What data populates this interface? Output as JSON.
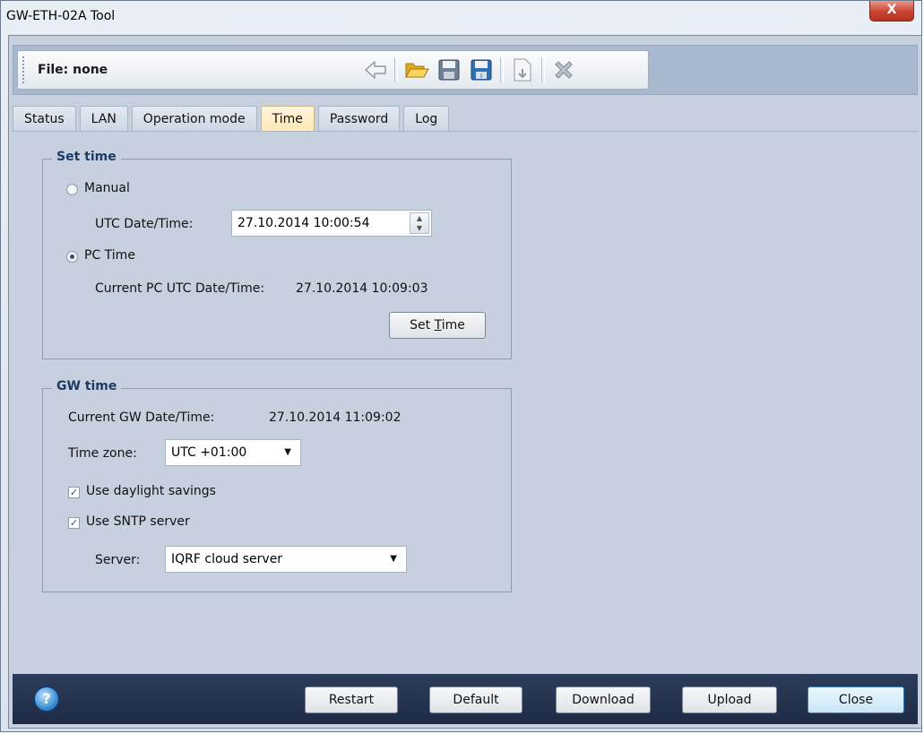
{
  "window": {
    "title": "GW-ETH-02A Tool",
    "close_glyph": "X"
  },
  "toolbar": {
    "file_label": "File: none",
    "icons": [
      "back-arrow-icon",
      "folder-open-icon",
      "save-icon",
      "save-as-icon",
      "export-document-icon",
      "delete-x-icon"
    ]
  },
  "tabs": [
    "Status",
    "LAN",
    "Operation mode",
    "Time",
    "Password",
    "Log"
  ],
  "active_tab": "Time",
  "set_time": {
    "legend": "Set time",
    "manual_label": "Manual",
    "utc_label": "UTC Date/Time:",
    "utc_value": "27.10.2014 10:00:54",
    "pc_time_label": "PC Time",
    "current_pc_label": "Current PC UTC Date/Time:",
    "current_pc_value": "27.10.2014 10:09:03",
    "set_time_button_pre": "Set ",
    "set_time_button_ul": "T",
    "set_time_button_post": "ime",
    "selected": "PC Time"
  },
  "gw_time": {
    "legend": "GW time",
    "current_gw_label": "Current GW Date/Time:",
    "current_gw_value": "27.10.2014 11:09:02",
    "timezone_label": "Time zone:",
    "timezone_value": "UTC +01:00",
    "daylight_label": "Use daylight savings",
    "daylight_checked": true,
    "sntp_label": "Use SNTP server",
    "sntp_checked": true,
    "server_label": "Server:",
    "server_value": "IQRF cloud server"
  },
  "footer": {
    "restart": "Restart",
    "default": "Default",
    "download": "Download",
    "upload": "Upload",
    "close": "Close",
    "help_glyph": "?"
  },
  "colors": {
    "tab_active": "#ffe7b5",
    "panel_bg": "#c6d0df",
    "legend_text": "#1f3a63",
    "footer_bg": "#1e2b45"
  }
}
